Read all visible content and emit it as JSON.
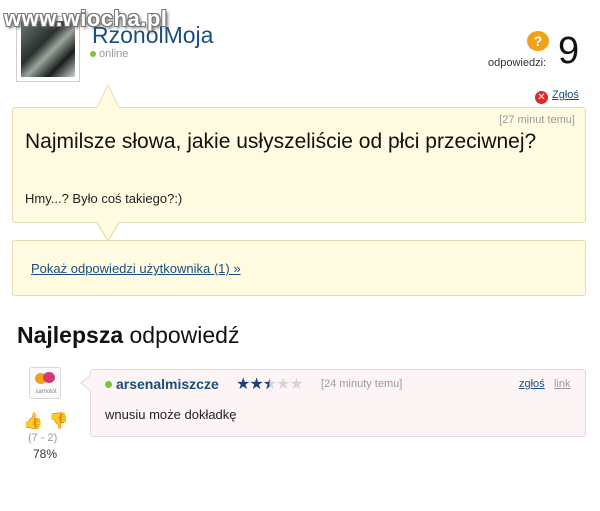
{
  "watermark": "www.wiocha.pl",
  "user": {
    "name": "RzonolMoja",
    "status": "online"
  },
  "answers": {
    "label": "odpowiedzi:",
    "count": "9",
    "icon": "question-bubble-icon"
  },
  "report_top": "Zgłoś",
  "question": {
    "time": "[27 minut temu]",
    "title": "Najmilsze słowa, jakie usłyszeliście od płci przeciwnej?",
    "body": "Hmy...? Było coś takiego?:)"
  },
  "show_answers_link": "Pokaż odpowiedzi użytkownika (1) »",
  "best_answer": {
    "heading_bold": "Najlepsza",
    "heading_rest": " odpowiedź",
    "side_icon_label": "samolot",
    "votes": "(7 - 2)",
    "percent": "78%",
    "user": "arsenalmiszcze",
    "rating": 2.5,
    "rating_max": 5,
    "time": "[24 minuty temu]",
    "report": "zgłoś",
    "link": "link",
    "text": "wnusiu może dokładkę"
  },
  "colors": {
    "link_blue": "#1a4e7f",
    "question_bg": "#fffbe0",
    "answer_bg": "#fdf5f5",
    "online_green": "#7fc33f",
    "accent_orange": "#f0a21a"
  }
}
